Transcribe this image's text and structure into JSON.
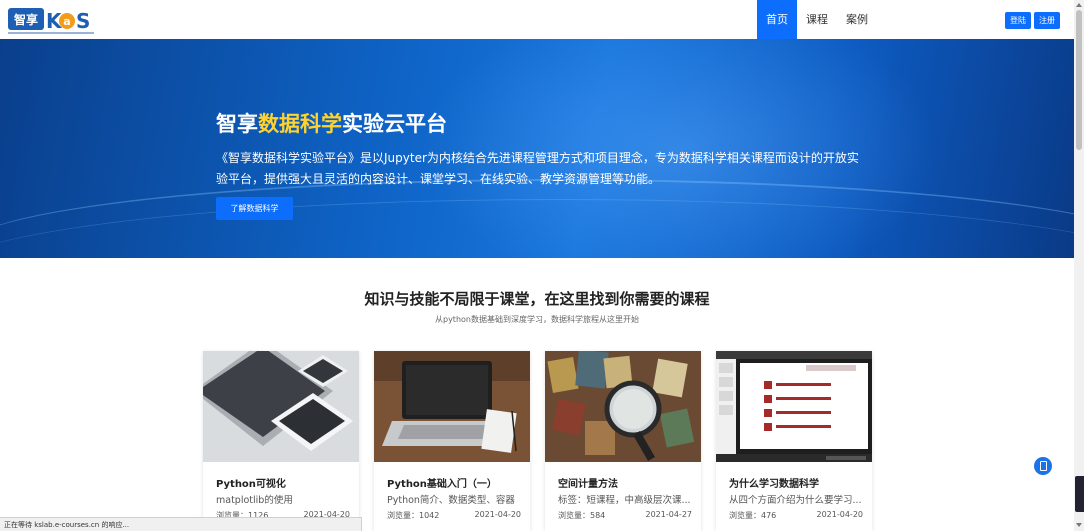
{
  "header": {
    "logo_text": "智享KaS",
    "nav": [
      "首页",
      "课程",
      "案例"
    ],
    "login": "登陆",
    "register": "注册"
  },
  "hero": {
    "title_prefix": "智享",
    "title_highlight": "数据科学",
    "title_suffix": "实验云平台",
    "description": "《智享数据科学实验平台》是以Jupyter为内核结合先进课程管理方式和项目理念，专为数据科学相关课程而设计的开放实验平台，提供强大且灵活的内容设计、课堂学习、在线实验、教学资源管理等功能。",
    "button": "了解数据科学"
  },
  "section": {
    "title": "知识与技能不局限于课堂，在这里找到你需要的课程",
    "subtitle": "从python数据基础到深度学习，数据科学旅程从这里开始"
  },
  "cards": [
    {
      "title": "Python可视化",
      "desc": "matplotlib的使用",
      "views": "浏览量：1126",
      "date": "2021-04-20"
    },
    {
      "title": "Python基础入门（一）",
      "desc": "Python简介、数据类型、容器",
      "views": "浏览量：1042",
      "date": "2021-04-20"
    },
    {
      "title": "空间计量方法",
      "desc": "标签：短课程，中高级层次课...",
      "views": "浏览量：584",
      "date": "2021-04-27"
    },
    {
      "title": "为什么学习数据科学",
      "desc": "从四个方面介绍为什么要学习...",
      "views": "浏览量：476",
      "date": "2021-04-20"
    }
  ],
  "status_bar": "正在等待 kslab.e-courses.cn 的响应...",
  "colors": {
    "primary": "#0d6efd",
    "hero_highlight": "#ffd22e"
  },
  "icons": [
    "phone-icon"
  ]
}
